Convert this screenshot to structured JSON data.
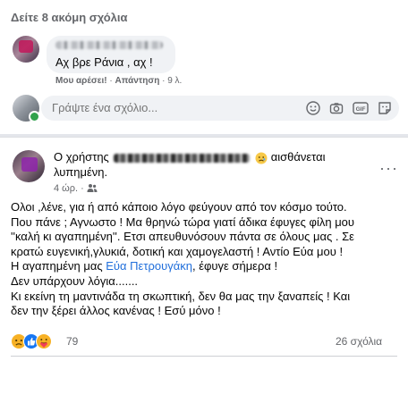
{
  "comments_section": {
    "see_more": "Δείτε 8 ακόμη σχόλια",
    "comment": {
      "text": "Αχ βρε Ράνια , αχ !",
      "like_label": "Μου αρέσει!",
      "reply_label": "Απάντηση",
      "time": "9 λ."
    },
    "composer": {
      "placeholder": "Γράψτε ένα σχόλιο...",
      "icons": [
        "emoji-icon",
        "camera-icon",
        "gif-icon",
        "sticker-icon"
      ]
    }
  },
  "post": {
    "header_prefix": "Ο χρήστης",
    "feeling": "αισθάνεται",
    "feeling_line2": "λυπημένη.",
    "time": "4 ώρ.",
    "body": {
      "line1": "Ολοι ,λένε, για ή από κάποιο λόγο φεύγουν από τον κόσμο τούτο.",
      "line2": "Που πάνε ; Αγνωστο ! Μα θρηνώ τώρα γιατί άδικα έφυγες φίλη μου",
      "line3": "''καλή κι αγαπημένη''. Ετσι απευθυνόσουν πάντα σε όλους μας . Σε",
      "line4": "κρατώ ευγενική,γλυκιά, δοτική και χαμογελαστή ! Αντίο Εύα μου !",
      "line5_a": "Η αγαπημένη μας ",
      "line5_link": "Εύα Πετρουγάκη",
      "line5_b": ", έφυγε σήμερα !",
      "line6": "Δεν υπάρχουν λόγια.......",
      "line7": "Κι εκείνη τη μαντινάδα τη σκωπτική, δεν θα μας την ξαναπείς ! Και",
      "line8": "δεν την ξέρει άλλος κανένας ! Εσύ μόνο !"
    },
    "reactions": {
      "count": "79",
      "types": [
        "sad-icon",
        "like-icon",
        "care-icon"
      ]
    },
    "comments_count": "26 σχόλια"
  },
  "colors": {
    "link": "#216fdb",
    "secondary_text": "#65676b",
    "bubble": "#f0f2f5",
    "online": "#31a24c"
  }
}
